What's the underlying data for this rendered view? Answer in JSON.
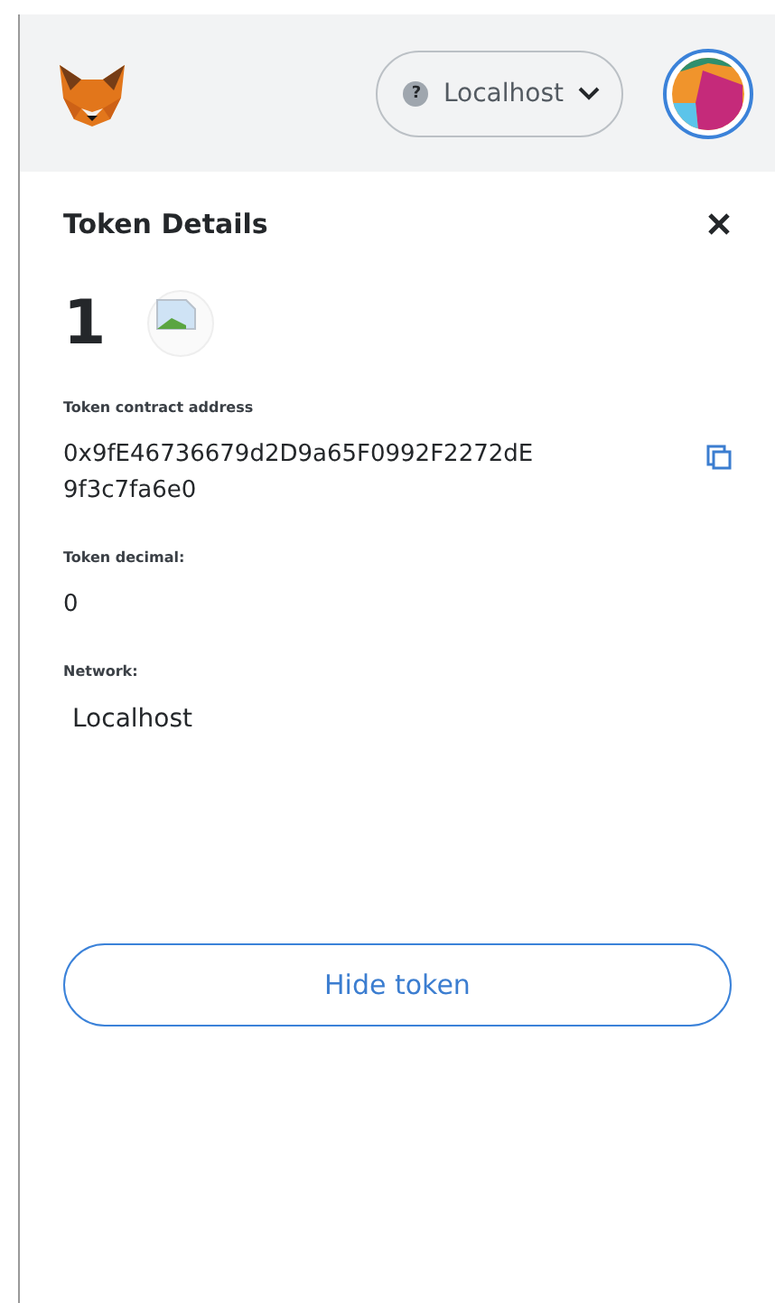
{
  "header": {
    "network": {
      "badge": "?",
      "label": "Localhost"
    }
  },
  "page": {
    "title": "Token Details",
    "balance": "1"
  },
  "fields": [
    {
      "label": "Token contract address",
      "value": "0x9fE46736679d2D9a65F0992F2272dE9f3c7fa6e0",
      "kind": "address"
    },
    {
      "label": "Token decimal:",
      "value": "0",
      "kind": "plain"
    },
    {
      "label": "Network:",
      "value": "Localhost",
      "kind": "network"
    }
  ],
  "buttons": [
    {
      "label": "Hide token"
    }
  ]
}
